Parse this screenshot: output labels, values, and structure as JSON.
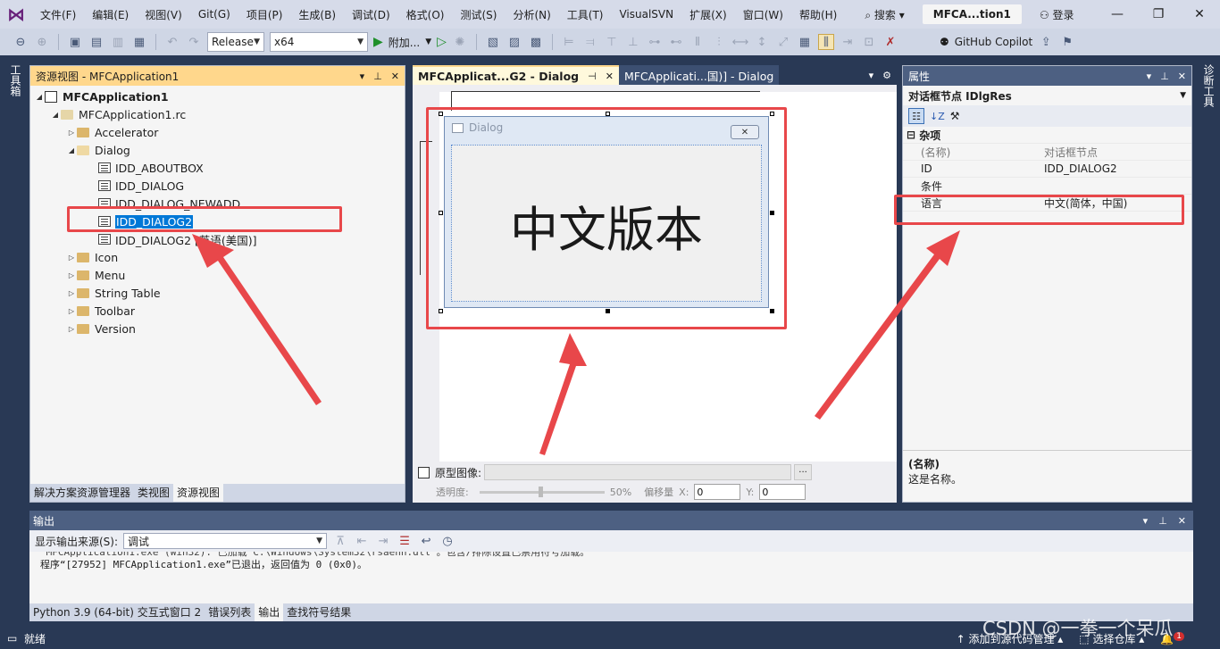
{
  "menubar": {
    "items": [
      "文件(F)",
      "编辑(E)",
      "视图(V)",
      "Git(G)",
      "项目(P)",
      "生成(B)",
      "调试(D)",
      "格式(O)",
      "测试(S)",
      "分析(N)",
      "工具(T)",
      "VisualSVN",
      "扩展(X)",
      "窗口(W)",
      "帮助(H)"
    ],
    "search": "搜索",
    "solution": "MFCA...tion1",
    "login": "登录"
  },
  "toolbar": {
    "config": "Release",
    "platform": "x64",
    "attach": "附加...",
    "copilot": "GitHub Copilot"
  },
  "left_strip": {
    "label": "工具箱"
  },
  "right_strip": {
    "label": "诊断工具"
  },
  "resource_view": {
    "title": "资源视图 - MFCApplication1",
    "tree": [
      {
        "label": "MFCApplication1"
      },
      {
        "label": "MFCApplication1.rc"
      },
      {
        "label": "Accelerator"
      },
      {
        "label": "Dialog"
      },
      {
        "label": "IDD_ABOUTBOX"
      },
      {
        "label": "IDD_DIALOG"
      },
      {
        "label": "IDD_DIALOG_NEWADD"
      },
      {
        "label": "IDD_DIALOG2"
      },
      {
        "label": "IDD_DIALOG2 [英语(美国)]"
      },
      {
        "label": "Icon"
      },
      {
        "label": "Menu"
      },
      {
        "label": "String Table"
      },
      {
        "label": "Toolbar"
      },
      {
        "label": "Version"
      }
    ],
    "tabs": [
      "解决方案资源管理器",
      "类视图",
      "资源视图"
    ]
  },
  "doc_tabs": [
    {
      "label": "MFCApplicat...G2 - Dialog"
    },
    {
      "label": "MFCApplicati...国)] - Dialog"
    }
  ],
  "dialog": {
    "title": "Dialog",
    "text": "中文版本"
  },
  "prototype": {
    "label": "原型图像:",
    "opacity_label": "透明度:",
    "opacity_value": "50%",
    "offset_label": "偏移量",
    "x_label": "X:",
    "x_value": "0",
    "y_label": "Y:",
    "y_value": "0",
    "browse": "..."
  },
  "properties": {
    "title": "属性",
    "object": "对话框节点  IDlgRes",
    "category": "杂项",
    "rows": [
      {
        "key": "(名称)",
        "value": "对话框节点"
      },
      {
        "key": "ID",
        "value": "IDD_DIALOG2"
      },
      {
        "key": "条件",
        "value": ""
      },
      {
        "key": "语言",
        "value": "中文(简体，中国)"
      }
    ],
    "desc_title": "(名称)",
    "desc_text": "这是名称。"
  },
  "output": {
    "title": "输出",
    "source_label": "显示输出来源(S):",
    "source_value": "调试",
    "lines": [
      "“MFCApplication1.exe”(Win32): 已加载“C:\\Windows\\System32\\rsaenh.dll”。包含/排除设置已禁用符号加载。",
      "程序“[27952] MFCApplication1.exe”已退出，返回值为 0 (0x0)。"
    ],
    "tabs": [
      "Python 3.9 (64-bit) 交互式窗口 2",
      "错误列表",
      "输出",
      "查找符号结果"
    ]
  },
  "status": {
    "ready": "就绪",
    "add_source": "添加到源代码管理",
    "select_repo": "选择仓库",
    "notifications": "1"
  },
  "watermark": "CSDN @一拳一个呆瓜",
  "colors": {
    "accent": "#0078d7",
    "annotation": "#e8474a",
    "title_active": "#ffd78c"
  }
}
